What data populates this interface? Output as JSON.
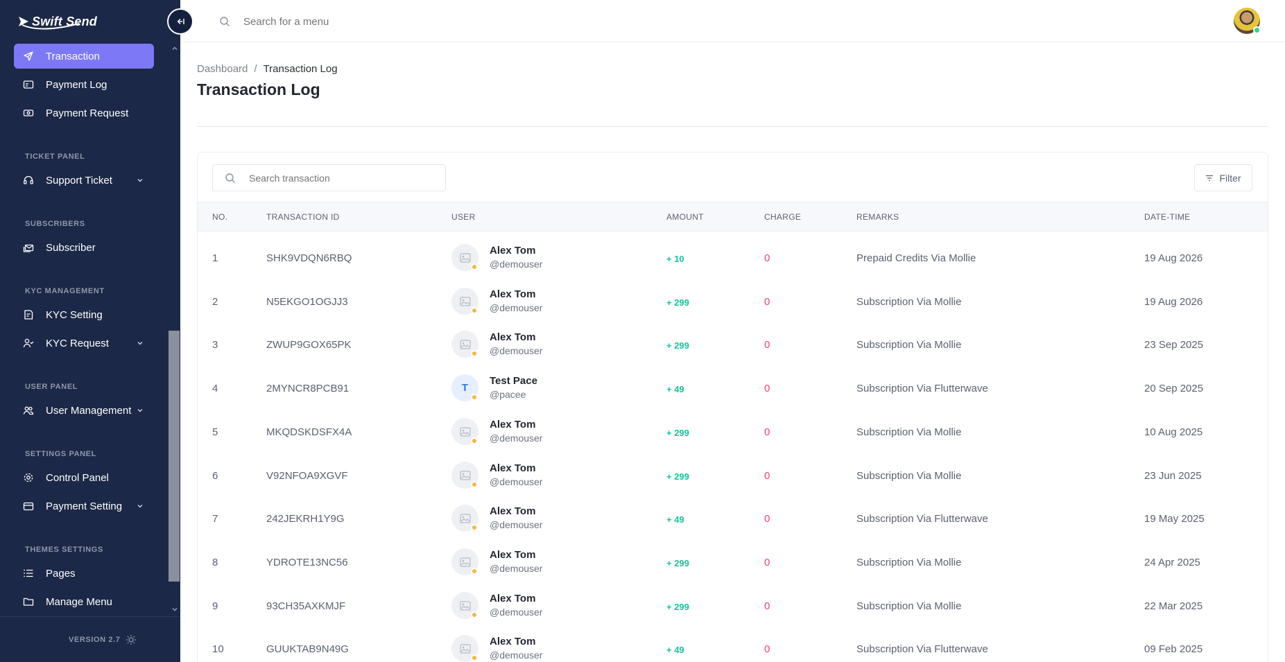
{
  "app": {
    "name": "Swift Send"
  },
  "sidebar": {
    "items": [
      {
        "label": "Transaction",
        "icon": "send-icon",
        "active": true
      },
      {
        "label": "Payment Log",
        "icon": "payment-log-icon"
      },
      {
        "label": "Payment Request",
        "icon": "cash-icon"
      }
    ],
    "sections": [
      {
        "title": "TICKET PANEL",
        "items": [
          {
            "label": "Support Ticket",
            "icon": "headset-icon",
            "expandable": true
          }
        ]
      },
      {
        "title": "SUBSCRIBERS",
        "items": [
          {
            "label": "Subscriber",
            "icon": "mail-stack-icon"
          }
        ]
      },
      {
        "title": "KYC MANAGEMENT",
        "items": [
          {
            "label": "KYC Setting",
            "icon": "id-card-icon"
          },
          {
            "label": "KYC Request",
            "icon": "user-check-icon",
            "expandable": true
          }
        ]
      },
      {
        "title": "USER PANEL",
        "items": [
          {
            "label": "User Management",
            "icon": "users-icon",
            "expandable": true
          }
        ]
      },
      {
        "title": "SETTINGS PANEL",
        "items": [
          {
            "label": "Control Panel",
            "icon": "gear-icon"
          },
          {
            "label": "Payment Setting",
            "icon": "wallet-icon",
            "expandable": true
          }
        ]
      },
      {
        "title": "THEMES SETTINGS",
        "items": [
          {
            "label": "Pages",
            "icon": "list-icon"
          },
          {
            "label": "Manage Menu",
            "icon": "folder-icon"
          }
        ]
      }
    ],
    "version": "VERSION 2.7"
  },
  "topbar": {
    "search_placeholder": "Search for a menu"
  },
  "breadcrumb": {
    "parent": "Dashboard",
    "separator": "/",
    "current": "Transaction Log"
  },
  "page_title": "Transaction Log",
  "table": {
    "search_placeholder": "Search transaction",
    "filter_label": "Filter",
    "headers": [
      "NO.",
      "TRANSACTION ID",
      "USER",
      "AMOUNT",
      "CHARGE",
      "REMARKS",
      "DATE-TIME"
    ],
    "rows": [
      {
        "no": "1",
        "id": "SHK9VDQN6RBQ",
        "name": "Alex Tom",
        "handle": "@demouser",
        "amount": "+ 10",
        "charge": "0",
        "remarks": "Prepaid Credits Via Mollie",
        "date": "19 Aug 2026"
      },
      {
        "no": "2",
        "id": "N5EKGO1OGJJ3",
        "name": "Alex Tom",
        "handle": "@demouser",
        "amount": "+ 299",
        "charge": "0",
        "remarks": "Subscription Via Mollie",
        "date": "19 Aug 2026"
      },
      {
        "no": "3",
        "id": "ZWUP9GOX65PK",
        "name": "Alex Tom",
        "handle": "@demouser",
        "amount": "+ 299",
        "charge": "0",
        "remarks": "Subscription Via Mollie",
        "date": "23 Sep 2025"
      },
      {
        "no": "4",
        "id": "2MYNCR8PCB91",
        "name": "Test Pace",
        "handle": "@pacee",
        "initial": "T",
        "amount": "+ 49",
        "charge": "0",
        "remarks": "Subscription Via Flutterwave",
        "date": "20 Sep 2025"
      },
      {
        "no": "5",
        "id": "MKQDSKDSFX4A",
        "name": "Alex Tom",
        "handle": "@demouser",
        "amount": "+ 299",
        "charge": "0",
        "remarks": "Subscription Via Mollie",
        "date": "10 Aug 2025"
      },
      {
        "no": "6",
        "id": "V92NFOA9XGVF",
        "name": "Alex Tom",
        "handle": "@demouser",
        "amount": "+ 299",
        "charge": "0",
        "remarks": "Subscription Via Mollie",
        "date": "23 Jun 2025"
      },
      {
        "no": "7",
        "id": "242JEKRH1Y9G",
        "name": "Alex Tom",
        "handle": "@demouser",
        "amount": "+ 49",
        "charge": "0",
        "remarks": "Subscription Via Flutterwave",
        "date": "19 May 2025"
      },
      {
        "no": "8",
        "id": "YDROTE13NC56",
        "name": "Alex Tom",
        "handle": "@demouser",
        "amount": "+ 299",
        "charge": "0",
        "remarks": "Subscription Via Mollie",
        "date": "24 Apr 2025"
      },
      {
        "no": "9",
        "id": "93CH35AXKMJF",
        "name": "Alex Tom",
        "handle": "@demouser",
        "amount": "+ 299",
        "charge": "0",
        "remarks": "Subscription Via Mollie",
        "date": "22 Mar 2025"
      },
      {
        "no": "10",
        "id": "GUUKTAB9N49G",
        "name": "Alex Tom",
        "handle": "@demouser",
        "amount": "+ 49",
        "charge": "0",
        "remarks": "Subscription Via Flutterwave",
        "date": "09 Feb 2025"
      }
    ]
  },
  "colors": {
    "sidebar_bg": "#1c2847",
    "accent": "#7d78f5",
    "amount_green": "#18c29c",
    "charge_red": "#f0426b",
    "status_online": "#2fd38e",
    "status_away": "#f5b73e"
  }
}
